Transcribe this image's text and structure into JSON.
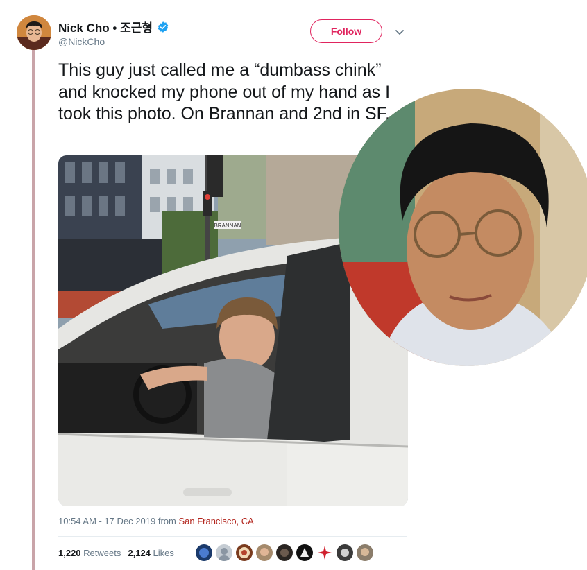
{
  "author": {
    "display_name": "Nick Cho • 조근형",
    "handle": "@NickCho",
    "verified": true
  },
  "follow_label": "Follow",
  "tweet_text": "This guy just called me a “dumbass chink” and knocked my phone out of my hand as I took this photo. On Brannan and 2nd in SF.",
  "photo_sign_text": "BRANNAN",
  "meta": {
    "time": "10:54 AM - 17 Dec 2019",
    "from_label": "from",
    "location": "San Francisco, CA"
  },
  "stats": {
    "retweets_count": "1,220",
    "retweets_label": "Retweets",
    "likes_count": "2,124",
    "likes_label": "Likes"
  },
  "colors": {
    "follow_accent": "#e0245e",
    "verified_blue": "#1da1f2",
    "location_link": "#b3261e",
    "thread_line": "#c9a4a9"
  },
  "icons": [
    "verified-badge-icon",
    "chevron-down-icon"
  ]
}
